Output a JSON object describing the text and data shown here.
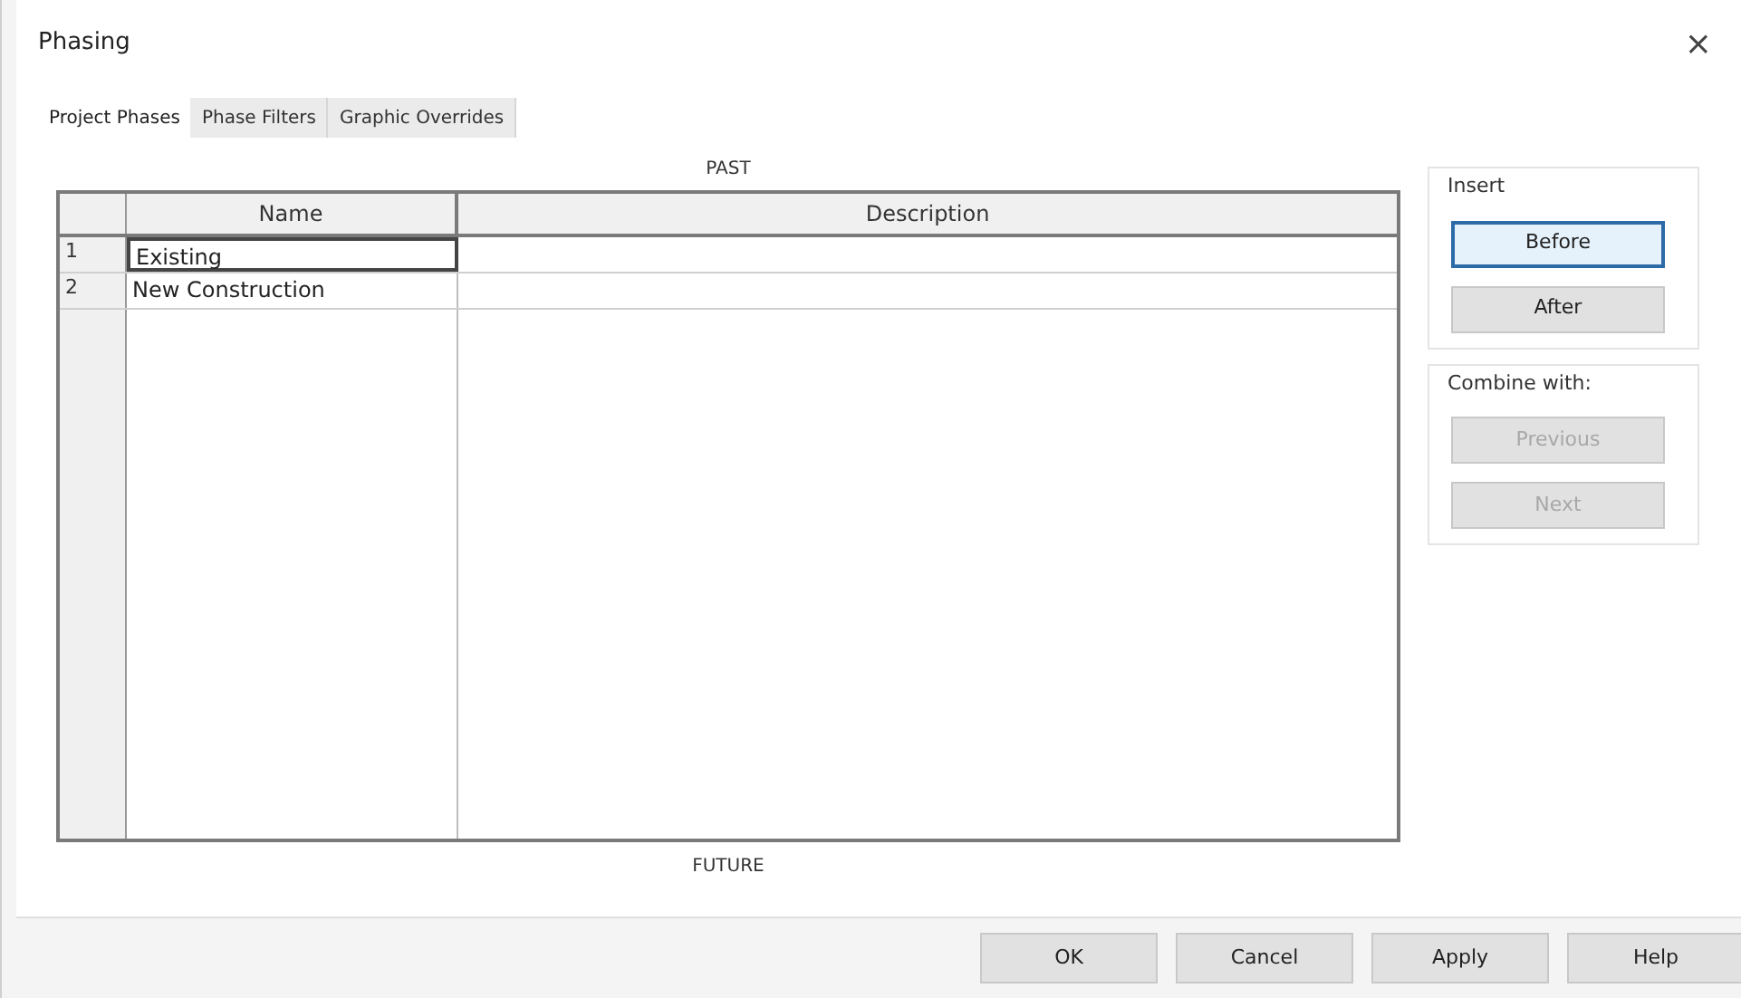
{
  "window": {
    "title": "Phasing",
    "close": "×"
  },
  "tabs": [
    {
      "label": "Project Phases",
      "selected": true
    },
    {
      "label": "Phase Filters",
      "selected": false
    },
    {
      "label": "Graphic Overrides",
      "selected": false
    }
  ],
  "past_label": "PAST",
  "future_label": "FUTURE",
  "table": {
    "columns": [
      "Name",
      "Description"
    ],
    "rows": [
      {
        "number": "1",
        "name": "Existing",
        "selected": true
      },
      {
        "number": "2",
        "name": "New Construction",
        "selected": false
      }
    ]
  },
  "insert": {
    "label": "Insert",
    "buttons": [
      {
        "label": "Before",
        "focused": true,
        "disabled": false
      },
      {
        "label": "After",
        "focused": false,
        "disabled": false
      }
    ]
  },
  "combine": {
    "label": "Combine with:",
    "buttons": [
      {
        "label": "Previous",
        "focused": false,
        "disabled": true
      },
      {
        "label": "Next",
        "focused": false,
        "disabled": true
      }
    ]
  },
  "footer_buttons": [
    "OK",
    "Cancel",
    "Apply",
    "Help"
  ]
}
